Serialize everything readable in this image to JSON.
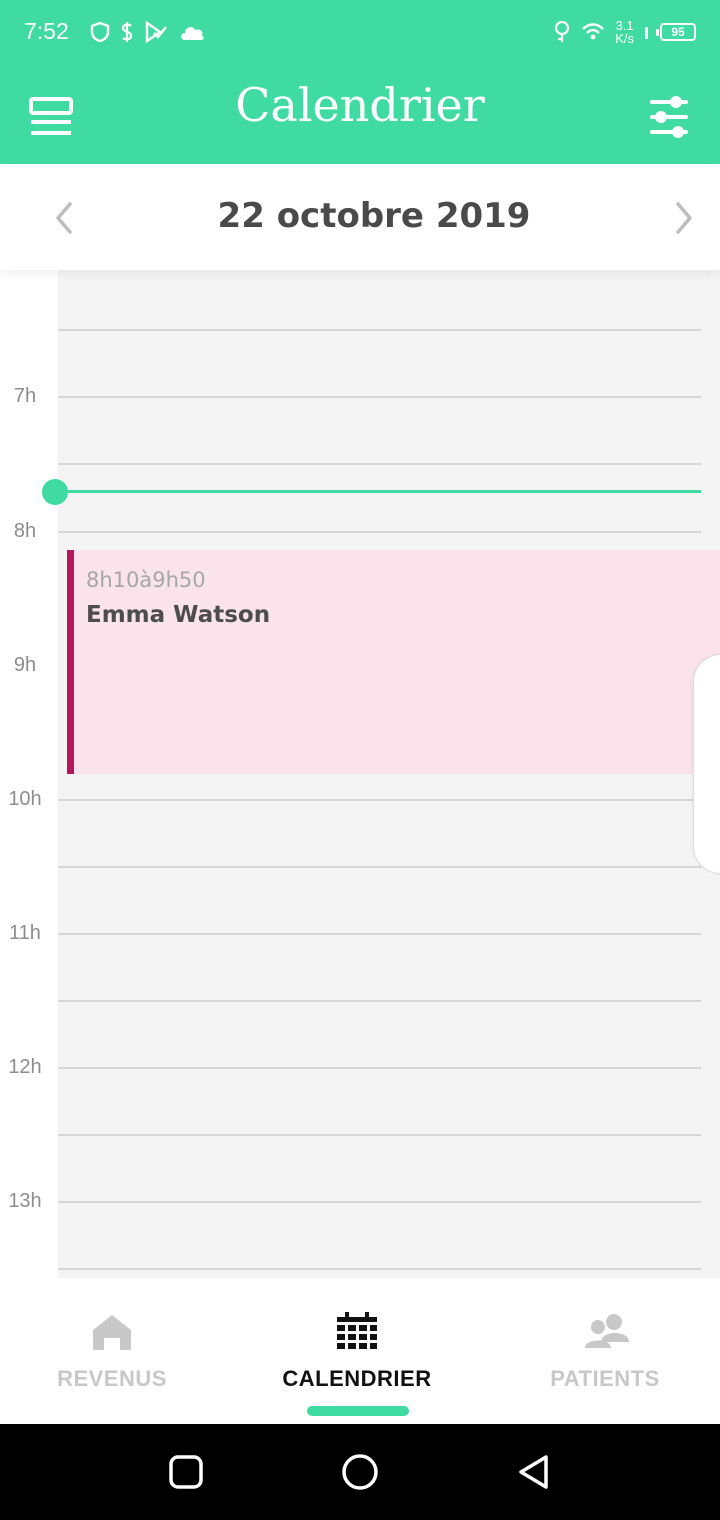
{
  "status_bar": {
    "time": "7:52",
    "net_speed_value": "3.1",
    "net_speed_unit": "K/s",
    "battery": "95",
    "icons": [
      "shield-icon",
      "dollar-icon",
      "play-check-icon",
      "cloud-icon",
      "location-pin-icon",
      "wifi-icon",
      "signal-icon",
      "battery-icon"
    ]
  },
  "header": {
    "title": "Calendrier",
    "menu_icon": "list-view-icon",
    "filters_icon": "sliders-icon"
  },
  "date_nav": {
    "date": "22 octobre 2019",
    "prev_icon": "chevron-left-icon",
    "next_icon": "chevron-right-icon"
  },
  "calendar": {
    "hour_labels": [
      "7h",
      "8h",
      "9h",
      "10h",
      "11h",
      "12h",
      "13h"
    ],
    "event": {
      "time": "8h10à9h50",
      "name": "Emma Watson",
      "accent_color": "#b5175d",
      "background_color": "#fae3ea"
    }
  },
  "bottom_nav": {
    "tabs": [
      {
        "label": "REVENUS",
        "icon": "home-icon",
        "active": false
      },
      {
        "label": "CALENDRIER",
        "icon": "calendar-grid-icon",
        "active": true
      },
      {
        "label": "PATIENTS",
        "icon": "users-icon",
        "active": false
      }
    ]
  },
  "system_nav": {
    "buttons": [
      "recents-button",
      "home-button",
      "back-button"
    ]
  },
  "colors": {
    "brand": "#3fdba2",
    "grid_background": "#f4f4f4",
    "text_dark": "#4a4a4a"
  }
}
